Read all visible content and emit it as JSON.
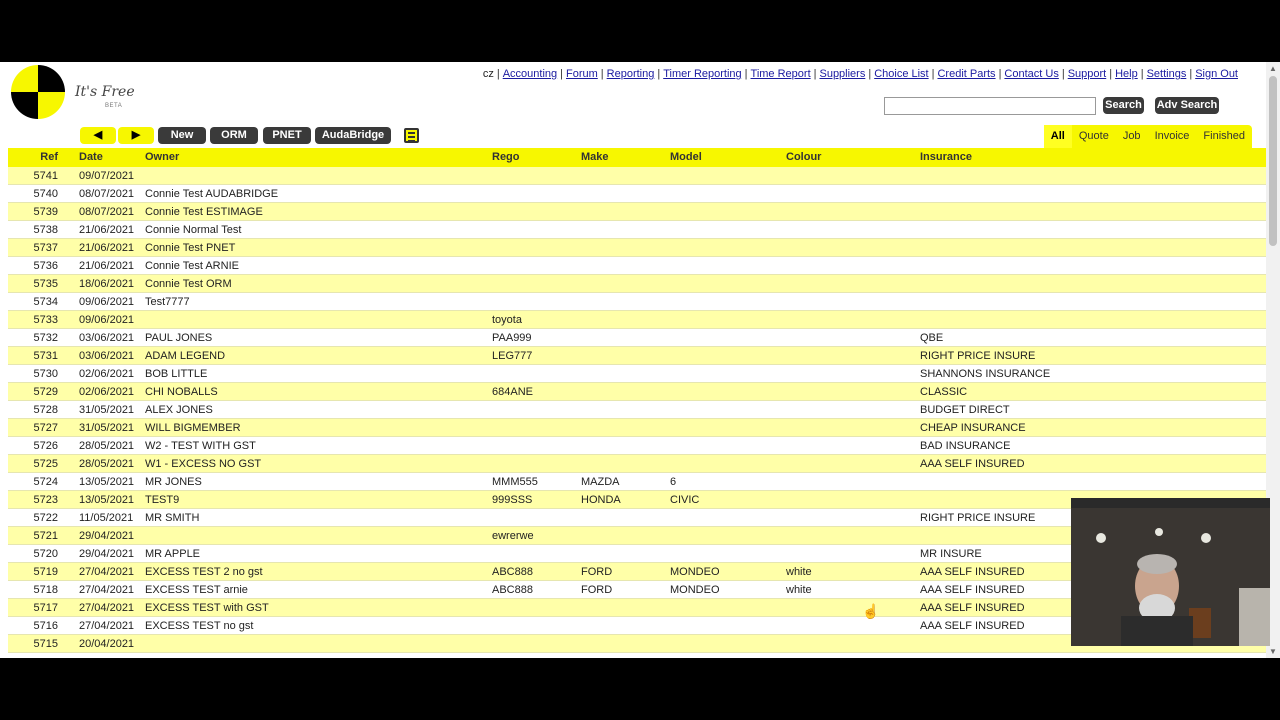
{
  "brand": {
    "name": "It's Free",
    "badge": "BETA"
  },
  "user": "cz",
  "nav_links": [
    "Accounting",
    "Forum",
    "Reporting",
    "Timer Reporting",
    "Time Report",
    "Suppliers",
    "Choice List",
    "Credit Parts",
    "Contact Us",
    "Support",
    "Help",
    "Settings",
    "Sign Out"
  ],
  "search": {
    "value": "",
    "button": "Search",
    "adv_button": "Adv Search"
  },
  "toolbar": {
    "prev": "◀",
    "next": "▶",
    "new": "New",
    "orm": "ORM",
    "pnet": "PNET",
    "audabridge": "AudaBridge"
  },
  "filters": {
    "all": "All",
    "quote": "Quote",
    "job": "Job",
    "invoice": "Invoice",
    "finished": "Finished"
  },
  "table": {
    "headers": {
      "ref": "Ref",
      "date": "Date",
      "owner": "Owner",
      "rego": "Rego",
      "make": "Make",
      "model": "Model",
      "colour": "Colour",
      "insurance": "Insurance"
    },
    "rows": [
      {
        "ref": "5741",
        "date": "09/07/2021",
        "owner": "",
        "rego": "",
        "make": "",
        "model": "",
        "colour": "",
        "insurance": ""
      },
      {
        "ref": "5740",
        "date": "08/07/2021",
        "owner": "Connie Test AUDABRIDGE",
        "rego": "",
        "make": "",
        "model": "",
        "colour": "",
        "insurance": ""
      },
      {
        "ref": "5739",
        "date": "08/07/2021",
        "owner": "Connie Test ESTIMAGE",
        "rego": "",
        "make": "",
        "model": "",
        "colour": "",
        "insurance": ""
      },
      {
        "ref": "5738",
        "date": "21/06/2021",
        "owner": "Connie Normal Test",
        "rego": "",
        "make": "",
        "model": "",
        "colour": "",
        "insurance": ""
      },
      {
        "ref": "5737",
        "date": "21/06/2021",
        "owner": "Connie Test PNET",
        "rego": "",
        "make": "",
        "model": "",
        "colour": "",
        "insurance": ""
      },
      {
        "ref": "5736",
        "date": "21/06/2021",
        "owner": "Connie Test ARNIE",
        "rego": "",
        "make": "",
        "model": "",
        "colour": "",
        "insurance": ""
      },
      {
        "ref": "5735",
        "date": "18/06/2021",
        "owner": "Connie Test ORM",
        "rego": "",
        "make": "",
        "model": "",
        "colour": "",
        "insurance": ""
      },
      {
        "ref": "5734",
        "date": "09/06/2021",
        "owner": "Test7777",
        "rego": "",
        "make": "",
        "model": "",
        "colour": "",
        "insurance": ""
      },
      {
        "ref": "5733",
        "date": "09/06/2021",
        "owner": "",
        "rego": "toyota",
        "make": "",
        "model": "",
        "colour": "",
        "insurance": ""
      },
      {
        "ref": "5732",
        "date": "03/06/2021",
        "owner": "PAUL JONES",
        "rego": "PAA999",
        "make": "",
        "model": "",
        "colour": "",
        "insurance": "QBE"
      },
      {
        "ref": "5731",
        "date": "03/06/2021",
        "owner": "ADAM LEGEND",
        "rego": "LEG777",
        "make": "",
        "model": "",
        "colour": "",
        "insurance": "RIGHT PRICE INSURE"
      },
      {
        "ref": "5730",
        "date": "02/06/2021",
        "owner": "BOB LITTLE",
        "rego": "",
        "make": "",
        "model": "",
        "colour": "",
        "insurance": "SHANNONS INSURANCE"
      },
      {
        "ref": "5729",
        "date": "02/06/2021",
        "owner": "CHI NOBALLS",
        "rego": "684ANE",
        "make": "",
        "model": "",
        "colour": "",
        "insurance": "CLASSIC"
      },
      {
        "ref": "5728",
        "date": "31/05/2021",
        "owner": "ALEX JONES",
        "rego": "",
        "make": "",
        "model": "",
        "colour": "",
        "insurance": "BUDGET DIRECT"
      },
      {
        "ref": "5727",
        "date": "31/05/2021",
        "owner": "WILL BIGMEMBER",
        "rego": "",
        "make": "",
        "model": "",
        "colour": "",
        "insurance": "CHEAP INSURANCE"
      },
      {
        "ref": "5726",
        "date": "28/05/2021",
        "owner": "W2 - TEST WITH GST",
        "rego": "",
        "make": "",
        "model": "",
        "colour": "",
        "insurance": "BAD INSURANCE"
      },
      {
        "ref": "5725",
        "date": "28/05/2021",
        "owner": "W1 - EXCESS NO GST",
        "rego": "",
        "make": "",
        "model": "",
        "colour": "",
        "insurance": "AAA SELF INSURED"
      },
      {
        "ref": "5724",
        "date": "13/05/2021",
        "owner": "MR JONES",
        "rego": "MMM555",
        "make": "MAZDA",
        "model": "6",
        "colour": "",
        "insurance": ""
      },
      {
        "ref": "5723",
        "date": "13/05/2021",
        "owner": "TEST9",
        "rego": "999SSS",
        "make": "HONDA",
        "model": "CIVIC",
        "colour": "",
        "insurance": ""
      },
      {
        "ref": "5722",
        "date": "11/05/2021",
        "owner": "MR SMITH",
        "rego": "",
        "make": "",
        "model": "",
        "colour": "",
        "insurance": "RIGHT PRICE INSURE"
      },
      {
        "ref": "5721",
        "date": "29/04/2021",
        "owner": "",
        "rego": "ewrerwe",
        "make": "",
        "model": "",
        "colour": "",
        "insurance": ""
      },
      {
        "ref": "5720",
        "date": "29/04/2021",
        "owner": "MR APPLE",
        "rego": "",
        "make": "",
        "model": "",
        "colour": "",
        "insurance": "MR INSURE"
      },
      {
        "ref": "5719",
        "date": "27/04/2021",
        "owner": "EXCESS TEST 2 no gst",
        "rego": "ABC888",
        "make": "FORD",
        "model": "MONDEO",
        "colour": "white",
        "insurance": "AAA SELF INSURED"
      },
      {
        "ref": "5718",
        "date": "27/04/2021",
        "owner": "EXCESS TEST arnie",
        "rego": "ABC888",
        "make": "FORD",
        "model": "MONDEO",
        "colour": "white",
        "insurance": "AAA SELF INSURED"
      },
      {
        "ref": "5717",
        "date": "27/04/2021",
        "owner": "EXCESS TEST with GST",
        "rego": "",
        "make": "",
        "model": "",
        "colour": "",
        "insurance": "AAA SELF INSURED"
      },
      {
        "ref": "5716",
        "date": "27/04/2021",
        "owner": "EXCESS TEST no gst",
        "rego": "",
        "make": "",
        "model": "",
        "colour": "",
        "insurance": "AAA SELF INSURED"
      },
      {
        "ref": "5715",
        "date": "20/04/2021",
        "owner": "",
        "rego": "",
        "make": "",
        "model": "",
        "colour": "",
        "insurance": ""
      }
    ]
  },
  "colors": {
    "accent": "#f7f700",
    "row_alt": "#ffffa8",
    "dark_button": "#3a3a3a",
    "link": "#1a1aa0"
  },
  "icons": {
    "logo": "crash-test-target-logo",
    "grid": "list-grid-icon",
    "cursor": "hand-pointer-icon"
  }
}
